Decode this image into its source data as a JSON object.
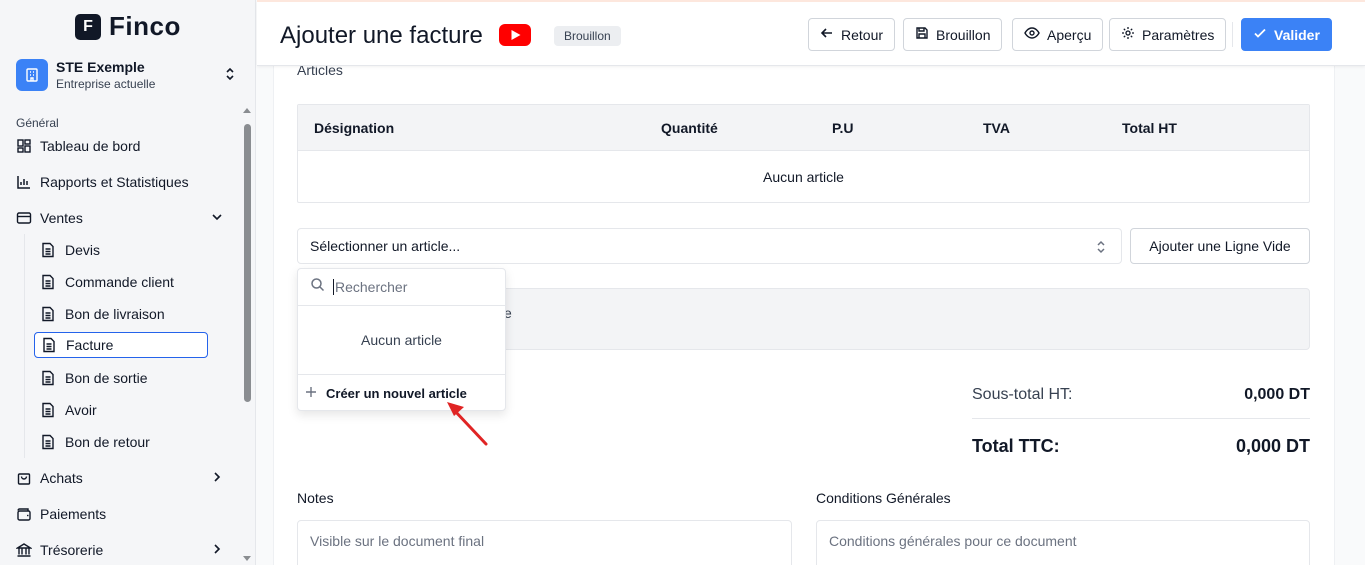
{
  "brand": {
    "logo_letter": "F",
    "name": "Finco"
  },
  "company": {
    "name": "STE Exemple",
    "subtitle": "Entreprise actuelle"
  },
  "sidebar": {
    "group_label": "Général",
    "items": [
      {
        "label": "Tableau de bord",
        "icon": "dashboard-icon"
      },
      {
        "label": "Rapports et Statistiques",
        "icon": "bar-chart-icon"
      },
      {
        "label": "Ventes",
        "icon": "card-icon",
        "expanded": true
      },
      {
        "label": "Achats",
        "icon": "shopping-bag-icon"
      },
      {
        "label": "Paiements",
        "icon": "wallet-icon"
      },
      {
        "label": "Trésorerie",
        "icon": "bank-icon"
      }
    ],
    "ventes_sub": [
      "Devis",
      "Commande client",
      "Bon de livraison",
      "Facture",
      "Bon de sortie",
      "Avoir",
      "Bon de retour"
    ],
    "active_sub": "Facture"
  },
  "header": {
    "title": "Ajouter une facture",
    "status_badge": "Brouillon",
    "buttons": {
      "back": "Retour",
      "draft": "Brouillon",
      "preview": "Aperçu",
      "settings": "Paramètres",
      "validate": "Valider"
    }
  },
  "articles": {
    "section_title": "Articles",
    "columns": [
      "Désignation",
      "Quantité",
      "P.U",
      "TVA",
      "Total HT"
    ],
    "empty_text": "Aucun article",
    "select_placeholder": "Sélectionner un article...",
    "add_empty_line": "Ajouter une Ligne Vide",
    "behind_text_fragment": "e"
  },
  "dropdown": {
    "search_placeholder": "Rechercher",
    "empty_text": "Aucun article",
    "create_label": "Créer un nouvel article"
  },
  "totals": {
    "subtotal_label": "Sous-total HT:",
    "subtotal_value": "0,000 DT",
    "total_label": "Total TTC:",
    "total_value": "0,000 DT"
  },
  "notes": {
    "label": "Notes",
    "placeholder": "Visible sur le document final"
  },
  "conditions": {
    "label": "Conditions Générales",
    "placeholder": "Conditions générales pour ce document"
  },
  "colors": {
    "primary": "#3b82f6",
    "active_border": "#2563eb",
    "youtube_red": "#ff0000",
    "annotation_arrow": "#e02424"
  }
}
